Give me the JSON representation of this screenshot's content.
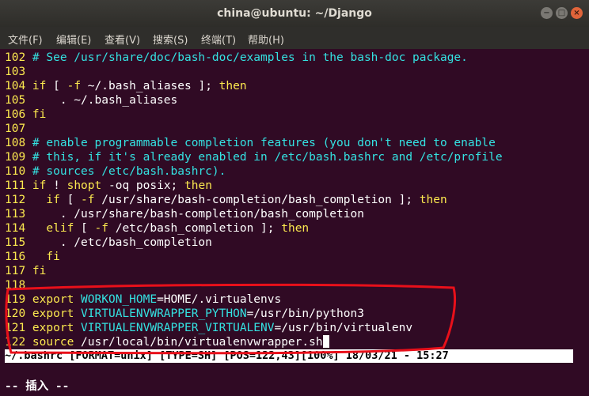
{
  "window": {
    "title": "china@ubuntu: ~/Django"
  },
  "menu": [
    "文件(F)",
    "编辑(E)",
    "查看(V)",
    "搜索(S)",
    "终端(T)",
    "帮助(H)"
  ],
  "lines": [
    {
      "n": "102",
      "parts": [
        {
          "t": "# See /usr/share/doc/bash-doc/examples in the bash-doc package.",
          "c": "cm"
        }
      ]
    },
    {
      "n": "103",
      "parts": []
    },
    {
      "n": "104",
      "parts": [
        {
          "t": "if",
          "c": "kw"
        },
        {
          "t": " [ ",
          "c": "code"
        },
        {
          "t": "-f",
          "c": "kw"
        },
        {
          "t": " ~/.bash_aliases ]; ",
          "c": "code"
        },
        {
          "t": "then",
          "c": "kw"
        }
      ]
    },
    {
      "n": "105",
      "parts": [
        {
          "t": "    . ~/.bash_aliases",
          "c": "code"
        }
      ]
    },
    {
      "n": "106",
      "parts": [
        {
          "t": "fi",
          "c": "kw"
        }
      ]
    },
    {
      "n": "107",
      "parts": []
    },
    {
      "n": "108",
      "parts": [
        {
          "t": "# enable programmable completion features (you don't need to enable",
          "c": "cm"
        }
      ]
    },
    {
      "n": "109",
      "parts": [
        {
          "t": "# this, if it's already enabled in /etc/bash.bashrc and /etc/profile",
          "c": "cm"
        }
      ]
    },
    {
      "n": "110",
      "parts": [
        {
          "t": "# sources /etc/bash.bashrc).",
          "c": "cm"
        }
      ]
    },
    {
      "n": "111",
      "parts": [
        {
          "t": "if",
          "c": "kw"
        },
        {
          "t": " ! ",
          "c": "code"
        },
        {
          "t": "shopt",
          "c": "kw"
        },
        {
          "t": " -oq posix; ",
          "c": "code"
        },
        {
          "t": "then",
          "c": "kw"
        }
      ]
    },
    {
      "n": "112",
      "parts": [
        {
          "t": "  if",
          "c": "kw"
        },
        {
          "t": " [ ",
          "c": "code"
        },
        {
          "t": "-f",
          "c": "kw"
        },
        {
          "t": " /usr/share/bash-completion/bash_completion ]; ",
          "c": "code"
        },
        {
          "t": "then",
          "c": "kw"
        }
      ]
    },
    {
      "n": "113",
      "parts": [
        {
          "t": "    . /usr/share/bash-completion/bash_completion",
          "c": "code"
        }
      ]
    },
    {
      "n": "114",
      "parts": [
        {
          "t": "  elif",
          "c": "kw"
        },
        {
          "t": " [ ",
          "c": "code"
        },
        {
          "t": "-f",
          "c": "kw"
        },
        {
          "t": " /etc/bash_completion ]; ",
          "c": "code"
        },
        {
          "t": "then",
          "c": "kw"
        }
      ]
    },
    {
      "n": "115",
      "parts": [
        {
          "t": "    . /etc/bash_completion",
          "c": "code"
        }
      ]
    },
    {
      "n": "116",
      "parts": [
        {
          "t": "  fi",
          "c": "kw"
        }
      ]
    },
    {
      "n": "117",
      "parts": [
        {
          "t": "fi",
          "c": "kw"
        }
      ]
    },
    {
      "n": "118",
      "parts": []
    },
    {
      "n": "119",
      "parts": [
        {
          "t": "export",
          "c": "kw"
        },
        {
          "t": " ",
          "c": "code"
        },
        {
          "t": "WORKON_HOME",
          "c": "var"
        },
        {
          "t": "=HOME/.virtualenvs",
          "c": "code"
        }
      ]
    },
    {
      "n": "120",
      "parts": [
        {
          "t": "export",
          "c": "kw"
        },
        {
          "t": " ",
          "c": "code"
        },
        {
          "t": "VIRTUALENVWRAPPER_PYTHON",
          "c": "var"
        },
        {
          "t": "=/usr/bin/python3",
          "c": "code"
        }
      ]
    },
    {
      "n": "121",
      "parts": [
        {
          "t": "export",
          "c": "kw"
        },
        {
          "t": " ",
          "c": "code"
        },
        {
          "t": "VIRTUALENVWRAPPER_VIRTUALENV",
          "c": "var"
        },
        {
          "t": "=/usr/bin/virtualenv",
          "c": "code"
        }
      ]
    },
    {
      "n": "122",
      "parts": [
        {
          "t": "source",
          "c": "kw"
        },
        {
          "t": " /usr/local/bin/virtualenvwrapper.sh",
          "c": "code"
        }
      ],
      "cursor": true
    }
  ],
  "status_line": "~/.bashrc [FORMAT=unix] [TYPE=SH] [POS=122,43][100%] 18/03/21 - 15:27",
  "mode_line": "-- 插入 --",
  "annotation_color": "#e8101a"
}
